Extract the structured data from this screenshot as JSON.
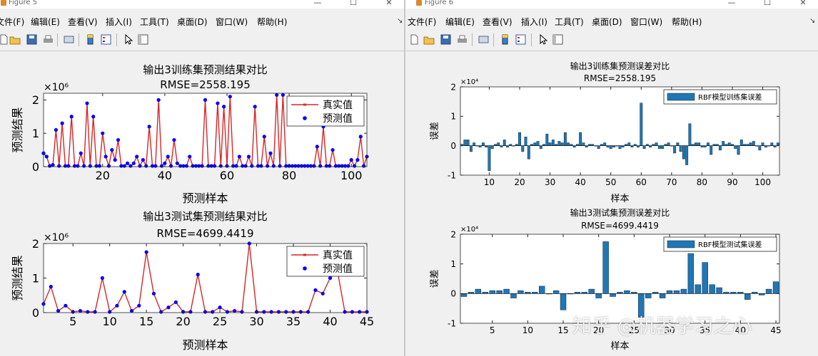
{
  "windows": {
    "fig5": {
      "title": "Figure 5",
      "menu": [
        "文件(F)",
        "编辑(E)",
        "查看(V)",
        "插入(I)",
        "工具(T)",
        "桌面(D)",
        "窗口(W)",
        "帮助(H)"
      ]
    },
    "fig6": {
      "title": "Figure 6",
      "menu": [
        "文件(F)",
        "编辑(E)",
        "查看(V)",
        "插入(I)",
        "工具(T)",
        "桌面(D)",
        "窗口(W)",
        "帮助(H)"
      ]
    }
  },
  "toolbar": {
    "icons": [
      "new-figure-icon",
      "open-file-icon",
      "save-icon",
      "print-icon",
      "link-icon",
      "colorbar-icon",
      "legend-icon",
      "pointer-icon",
      "plot-tools-icon"
    ]
  },
  "colors": {
    "true_line": "#d62728",
    "pred_marker": "#0000ff",
    "bar": "#1f77b4",
    "window_bg": "#f0f0f0"
  },
  "watermark": "知乎 @机器学习之心",
  "chart_data": [
    {
      "type": "line",
      "title": "输出3训练集预测结果对比",
      "subtitle": "RMSE=2558.195",
      "xlabel": "预测样本",
      "ylabel": "预测结果",
      "exponent": "×10⁶",
      "xlim": [
        1,
        105
      ],
      "ylim": [
        0,
        2.2
      ],
      "xticks": [
        20,
        40,
        60,
        80,
        100
      ],
      "yticks": [
        0,
        1,
        2
      ],
      "legend": [
        "真实值",
        "预测值"
      ],
      "legend_position": "top-right",
      "series": [
        {
          "name": "真实值",
          "values": [
            0.4,
            0.3,
            0.02,
            0.05,
            1.1,
            0.02,
            1.3,
            0.02,
            0.02,
            1.5,
            0.02,
            0.02,
            0.4,
            0.02,
            1.9,
            0.02,
            1.5,
            0.02,
            0.02,
            1.0,
            0.3,
            0.02,
            0.5,
            0.2,
            0.8,
            0.02,
            0.02,
            0.1,
            0.02,
            0.1,
            0.3,
            0.02,
            0.2,
            0.02,
            1.2,
            0.02,
            0.02,
            2.0,
            0.02,
            0.1,
            0.3,
            0.02,
            0.8,
            0.1,
            0.02,
            0.02,
            0.02,
            0.3,
            0.02,
            0.02,
            0.02,
            0.02,
            2.0,
            0.02,
            0.02,
            0.02,
            1.9,
            0.02,
            1.8,
            0.02,
            2.1,
            0.02,
            0.02,
            0.3,
            0.02,
            0.02,
            0.3,
            0.02,
            1.8,
            0.02,
            0.02,
            0.9,
            0.02,
            0.4,
            0.02,
            2.15,
            0.02,
            2.15,
            0.02,
            0.02,
            0.02,
            0.02,
            0.02,
            0.02,
            0.02,
            0.02,
            0.02,
            0.02,
            0.6,
            0.02,
            1.2,
            0.02,
            0.02,
            0.5,
            0.02,
            0.02,
            0.02,
            0.02,
            0.02,
            0.2,
            0.02,
            0.2,
            0.9,
            0.02,
            0.3
          ]
        },
        {
          "name": "预测值",
          "values": [
            0.4,
            0.3,
            0.02,
            0.05,
            1.1,
            0.02,
            1.3,
            0.02,
            0.02,
            1.5,
            0.02,
            0.02,
            0.4,
            0.02,
            1.9,
            0.02,
            1.5,
            0.02,
            0.02,
            1.0,
            0.3,
            0.02,
            0.5,
            0.2,
            0.8,
            0.02,
            0.02,
            0.1,
            0.02,
            0.1,
            0.3,
            0.02,
            0.2,
            0.02,
            1.2,
            0.02,
            0.02,
            2.0,
            0.02,
            0.1,
            0.3,
            0.02,
            0.8,
            0.1,
            0.02,
            0.02,
            0.02,
            0.3,
            0.02,
            0.02,
            0.02,
            0.02,
            2.0,
            0.02,
            0.02,
            0.02,
            1.9,
            0.02,
            1.8,
            0.02,
            2.1,
            0.02,
            0.02,
            0.3,
            0.02,
            0.02,
            0.3,
            0.02,
            1.8,
            0.02,
            0.02,
            0.9,
            0.02,
            0.4,
            0.02,
            2.15,
            0.02,
            2.15,
            0.02,
            0.02,
            0.02,
            0.02,
            0.02,
            0.02,
            0.02,
            0.02,
            0.02,
            0.02,
            0.6,
            0.02,
            1.2,
            0.02,
            0.02,
            0.5,
            0.02,
            0.02,
            0.02,
            0.02,
            0.02,
            0.2,
            0.02,
            0.2,
            0.9,
            0.02,
            0.3
          ]
        }
      ]
    },
    {
      "type": "line",
      "title": "输出3测试集预测结果对比",
      "subtitle": "RMSE=4699.4419",
      "xlabel": "预测样本",
      "ylabel": "预测结果",
      "exponent": "×10⁶",
      "xlim": [
        1,
        45
      ],
      "ylim": [
        0,
        2
      ],
      "xticks": [
        5,
        10,
        15,
        20,
        25,
        30,
        35,
        40,
        45
      ],
      "yticks": [
        0,
        1,
        2
      ],
      "legend": [
        "真实值",
        "预测值"
      ],
      "legend_position": "top-right",
      "series": [
        {
          "name": "真实值",
          "values": [
            0.25,
            0.75,
            0.05,
            0.2,
            0.02,
            0.05,
            0.02,
            0.02,
            1.0,
            0.02,
            0.2,
            0.6,
            0.05,
            0.2,
            1.75,
            0.55,
            0.02,
            0.15,
            0.3,
            0.02,
            0.02,
            1.1,
            0.02,
            0.02,
            0.15,
            0.02,
            0.05,
            0.02,
            2.0,
            0.02,
            0.02,
            0.02,
            0.02,
            0.02,
            0.02,
            0.02,
            0.02,
            0.65,
            0.55,
            1.0,
            1.2,
            0.02,
            0.02,
            0.02,
            0.02
          ]
        },
        {
          "name": "预测值",
          "values": [
            0.25,
            0.75,
            0.05,
            0.2,
            0.02,
            0.05,
            0.02,
            0.02,
            1.0,
            0.02,
            0.2,
            0.6,
            0.05,
            0.2,
            1.75,
            0.55,
            0.02,
            0.15,
            0.3,
            0.02,
            0.02,
            1.1,
            0.02,
            0.02,
            0.15,
            0.02,
            0.05,
            0.02,
            2.0,
            0.02,
            0.02,
            0.02,
            0.02,
            0.02,
            0.02,
            0.02,
            0.02,
            0.65,
            0.55,
            1.0,
            1.2,
            0.02,
            0.02,
            0.02,
            0.02
          ]
        }
      ]
    },
    {
      "type": "bar",
      "title": "输出3训练集预测误差对比",
      "subtitle": "RMSE=2558.195",
      "xlabel": "样本",
      "ylabel": "误差",
      "exponent": "×10⁴",
      "xlim": [
        1,
        105
      ],
      "ylim": [
        -1,
        2
      ],
      "xticks": [
        10,
        20,
        30,
        40,
        50,
        60,
        70,
        80,
        90,
        100
      ],
      "yticks": [
        -1,
        0,
        1,
        2
      ],
      "legend": [
        "RBF模型训练集误差"
      ],
      "legend_position": "top-right",
      "series": [
        {
          "name": "RBF模型训练集误差",
          "values": [
            0.05,
            0.2,
            0.2,
            -0.2,
            0.1,
            0,
            -0.05,
            0.1,
            -0.05,
            -0.85,
            -0.1,
            0.05,
            0.1,
            -0.05,
            0.2,
            -0.05,
            0.05,
            0,
            0.05,
            0.45,
            -0.2,
            0.3,
            -0.45,
            0.05,
            0.1,
            0.15,
            -0.1,
            0.05,
            0.4,
            0.1,
            0.2,
            0.05,
            0.15,
            0.1,
            0.45,
            0.1,
            0.05,
            -0.05,
            0.05,
            0.45,
            0.1,
            -0.05,
            0.05,
            0.05,
            0,
            -0.1,
            0.05,
            0.1,
            -0.05,
            -0.1,
            -0.05,
            0,
            -0.1,
            -0.05,
            0.05,
            0.1,
            -0.05,
            0.05,
            -0.05,
            1.45,
            -0.1,
            0.05,
            -0.05,
            0.05,
            0.1,
            -0.1,
            -0.1,
            0.05,
            0.1,
            0,
            -0.25,
            0.1,
            -0.2,
            -0.45,
            -0.65,
            0.75,
            0.05,
            0.1,
            0.1,
            -0.05,
            -0.05,
            0.1,
            -0.3,
            0.05,
            0.05,
            -0.15,
            0.15,
            0.05,
            0.1,
            0.05,
            -0.1,
            -0.3,
            0.2,
            0.05,
            0.05,
            0.1,
            0.15,
            0,
            -0.15,
            0.1,
            -0.05,
            0,
            0.1,
            -0.05,
            0.1
          ]
        }
      ]
    },
    {
      "type": "bar",
      "title": "输出3测试集预测误差对比",
      "subtitle": "RMSE=4699.4419",
      "xlabel": "样本",
      "ylabel": "误差",
      "exponent": "×10⁴",
      "xlim": [
        1,
        45
      ],
      "ylim": [
        -1,
        2
      ],
      "xticks": [
        5,
        10,
        15,
        20,
        25,
        30,
        35,
        40,
        45
      ],
      "yticks": [
        -1,
        0,
        1,
        2
      ],
      "legend": [
        "RBF模型测试集误差"
      ],
      "legend_position": "top-right",
      "series": [
        {
          "name": "RBF模型测试集误差",
          "values": [
            -0.1,
            0.05,
            0.15,
            0.05,
            0.1,
            0.1,
            0.15,
            -0.15,
            0.1,
            0.05,
            0.05,
            0.25,
            0,
            0.1,
            -0.55,
            0,
            0.05,
            0.05,
            0.15,
            -0.15,
            1.75,
            -0.1,
            0.05,
            0.1,
            0.05,
            -0.8,
            -0.15,
            0.05,
            -0.15,
            0.1,
            0.1,
            0.15,
            1.35,
            0.3,
            1.05,
            0.3,
            0.2,
            0.05,
            0.05,
            0.05,
            -0.2,
            0.05,
            -0.05,
            0.15,
            0.4
          ]
        }
      ]
    }
  ]
}
